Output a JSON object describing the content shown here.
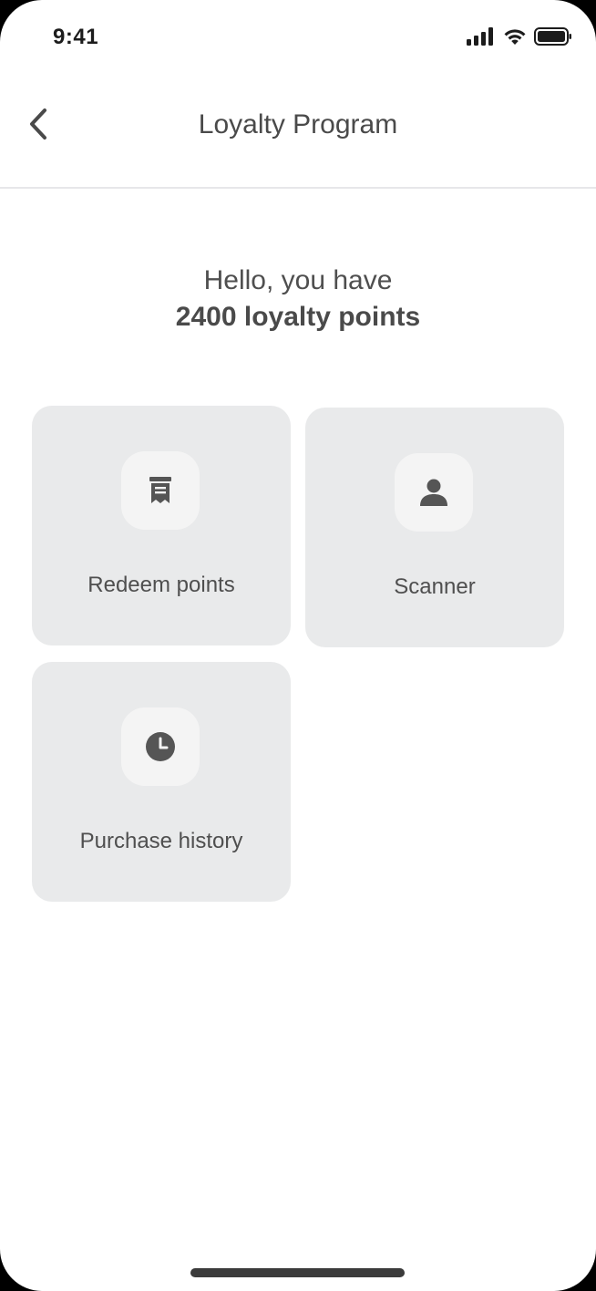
{
  "status_bar": {
    "time": "9:41"
  },
  "nav": {
    "title": "Loyalty Program",
    "back_icon": "chevron-left-icon"
  },
  "greeting": {
    "line1": "Hello, you have",
    "points": "2400 loyalty points"
  },
  "tiles": [
    {
      "label": "Redeem points",
      "icon": "receipt-icon"
    },
    {
      "label": "Scanner",
      "icon": "person-icon"
    },
    {
      "label": "Purchase history",
      "icon": "clock-icon"
    }
  ],
  "colors": {
    "background": "#ffffff",
    "tile_background": "#e9eaeb",
    "icon_background": "#f4f4f4",
    "text": "#4f4f4f",
    "icon": "#555555"
  }
}
